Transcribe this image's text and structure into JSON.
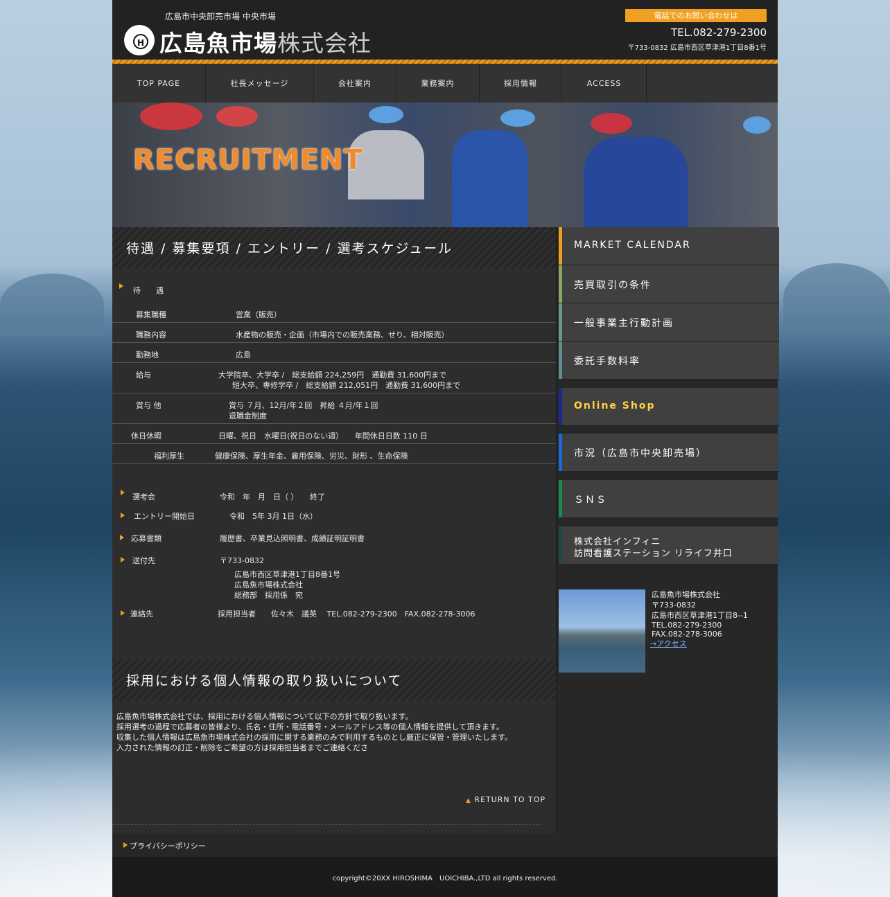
{
  "header": {
    "subtitle": "広島市中央卸売市場 中央市場",
    "logo_main": "広島魚市場",
    "logo_suffix": "株式会社",
    "logo_letter": "H",
    "tel_label": "電話でのお問い合わせは",
    "tel": "TEL.082-279-2300",
    "address": "〒733-0832 広島市西区草津港1丁目8番1号"
  },
  "nav": [
    {
      "label": "TOP PAGE"
    },
    {
      "label": "社長メッセージ"
    },
    {
      "label": "会社案内"
    },
    {
      "label": "業務案内"
    },
    {
      "label": "採用情報"
    },
    {
      "label": "ACCESS"
    }
  ],
  "hero": {
    "title": "RECRUITMENT"
  },
  "section1": {
    "title": "待遇 / 募集要項 / エントリー / 選考スケジュール",
    "heading": "待　　遇",
    "rows": [
      {
        "label": "募集職種",
        "value": "営業（販売）"
      },
      {
        "label": "職務内容",
        "value": "水産物の販売・企画（市場内での販売業務、せり、相対販売）"
      },
      {
        "label": "勤務地",
        "value": "広島"
      },
      {
        "label": "給与",
        "value": "大学院卒、大学卒 /　総支給額 224,259円　通勤費 31,600円まで",
        "value2": "短大卒、専修学卒 /　総支給額 212,051円　通勤費 31,600円まで"
      },
      {
        "label": "賞与  他",
        "value": "賞与 ７月、12月/年２回　昇給 ４月/年１回",
        "value2": "退職金制度"
      },
      {
        "label": "休日休暇",
        "value": "日曜、祝日　水曜日(祝日のない週）　　年間休日日数 110 日"
      },
      {
        "label": "福利厚生",
        "value": "健康保険、厚生年金、雇用保険、労災、財形 、生命保険"
      }
    ],
    "schedule": [
      {
        "label": "選考会",
        "value": "令和　年　月　日（ ）　　終了"
      },
      {
        "label": "エントリー開始日",
        "value": "令和　5年 3月  1日（水）"
      },
      {
        "label": "応募書類",
        "value": "履歴書、卒業見込照明書、成績証明証明書"
      },
      {
        "label": "送付先",
        "value": "〒733-0832",
        "lines": [
          "広島市西区草津港1丁目8番1号",
          "広島魚市場株式会社",
          "総務部　採用係　宛"
        ]
      },
      {
        "label": "連絡先",
        "value": "採用担当者　　佐々木　議英　 TEL.082-279-2300　FAX.082-278-3006"
      }
    ]
  },
  "section2": {
    "title": "採用における個人情報の取り扱いについて",
    "paragraphs": [
      "広島魚市場株式会社では、採用における個人情報について以下の方針で取り扱います。",
      "採用選考の過程で応募者の皆様より、氏名・住所・電話番号・メールアドレス等の個人情報を提供して頂きます。",
      "収集した個人情報は広島魚市場株式会社の採用に関する業務のみで利用するものとし厳正に保管・管理いたします。",
      "入力された情報の訂正・削除をご希望の方は採用担当者までご連絡くださ"
    ],
    "return_top": "RETURN TO TOP"
  },
  "sidebar": {
    "buttons": [
      {
        "label": "MARKET CALENDAR",
        "color": "#f0a020"
      },
      {
        "label": "売買取引の条件",
        "color": "#8aa860"
      },
      {
        "label": "一般事業主行動計画",
        "color": "#6a9a80"
      },
      {
        "label": "委託手数料率",
        "color": "#5d8f95"
      },
      {
        "label": "Online Shop",
        "color": "#1a2a90"
      },
      {
        "label": "市況（広島市中央卸売場）",
        "color": "#1a6ad8"
      },
      {
        "label": "ＳＮＳ",
        "color": "#1a8a4a"
      },
      {
        "label": "株式会社インフィニ",
        "label2": "訪問看護ステーション リライフ井口",
        "color": "#1a4a4a"
      }
    ],
    "info": {
      "company": "広島魚市場株式会社",
      "zip": "〒733-0832",
      "address": "広島市西区草津港1丁目8--1",
      "tel": "TEL.082-279-2300",
      "fax": "FAX.082-278-3006",
      "access_link": "→アクセス"
    }
  },
  "footer": {
    "privacy": "プライバシーポリシー",
    "copyright": "copyright©20XX HIROSHIMA　UOICHIBA.,LTD all rights reserved."
  }
}
